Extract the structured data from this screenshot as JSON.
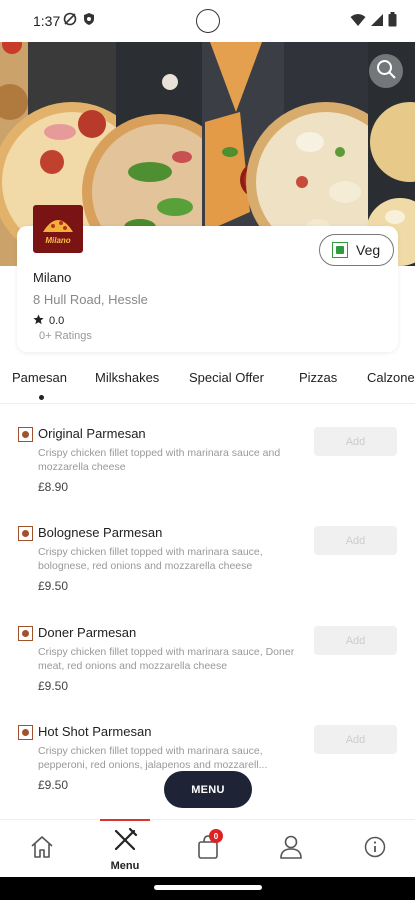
{
  "status_bar": {
    "time": "1:37"
  },
  "restaurant": {
    "name": "Milano",
    "address": "8 Hull Road, Hessle",
    "rating": "0.0",
    "ratings_count": "0+ Ratings",
    "logo_text": "Milano"
  },
  "veg_toggle": {
    "label": "Veg",
    "color": "#2e9b3f"
  },
  "tabs": [
    {
      "label": "Pamesan"
    },
    {
      "label": "Milkshakes"
    },
    {
      "label": "Special Offer"
    },
    {
      "label": "Pizzas"
    },
    {
      "label": "Calzone"
    }
  ],
  "menu_items": [
    {
      "name": "Original Parmesan",
      "description": "Crispy chicken fillet topped with marinara sauce and mozzarella cheese",
      "price": "£8.90",
      "add_label": "Add"
    },
    {
      "name": "Bolognese Parmesan",
      "description": "Crispy chicken fillet topped with marinara sauce, bolognese, red onions and mozzarella cheese",
      "price": "£9.50",
      "add_label": "Add"
    },
    {
      "name": "Doner Parmesan",
      "description": "Crispy chicken fillet topped with marinara sauce, Doner meat, red onions and mozzarella cheese",
      "price": "£9.50",
      "add_label": "Add"
    },
    {
      "name": "Hot Shot Parmesan",
      "description": "Crispy chicken fillet topped with marinara sauce, pepperoni, red onions, jalapenos and mozzarell...",
      "price": "£9.50",
      "add_label": "Add"
    }
  ],
  "menu_button": {
    "label": "MENU"
  },
  "bottom_nav": {
    "menu_label": "Menu",
    "cart_count": "0"
  },
  "colors": {
    "accent": "#d33333",
    "fab": "#1e2436",
    "item_icon": "#a0522d"
  }
}
